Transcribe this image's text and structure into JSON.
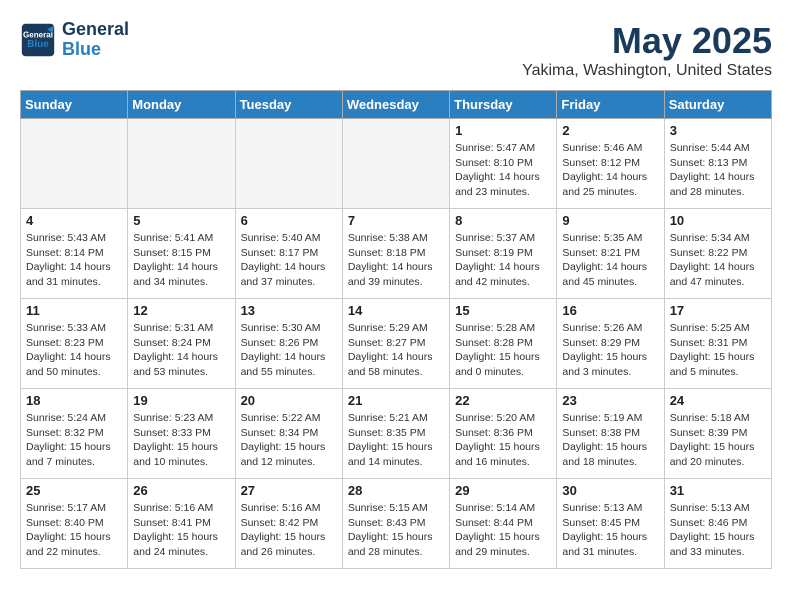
{
  "header": {
    "logo_line1": "General",
    "logo_line2": "Blue",
    "month_title": "May 2025",
    "location": "Yakima, Washington, United States"
  },
  "columns": [
    "Sunday",
    "Monday",
    "Tuesday",
    "Wednesday",
    "Thursday",
    "Friday",
    "Saturday"
  ],
  "weeks": [
    [
      {
        "day": "",
        "info": ""
      },
      {
        "day": "",
        "info": ""
      },
      {
        "day": "",
        "info": ""
      },
      {
        "day": "",
        "info": ""
      },
      {
        "day": "1",
        "info": "Sunrise: 5:47 AM\nSunset: 8:10 PM\nDaylight: 14 hours\nand 23 minutes."
      },
      {
        "day": "2",
        "info": "Sunrise: 5:46 AM\nSunset: 8:12 PM\nDaylight: 14 hours\nand 25 minutes."
      },
      {
        "day": "3",
        "info": "Sunrise: 5:44 AM\nSunset: 8:13 PM\nDaylight: 14 hours\nand 28 minutes."
      }
    ],
    [
      {
        "day": "4",
        "info": "Sunrise: 5:43 AM\nSunset: 8:14 PM\nDaylight: 14 hours\nand 31 minutes."
      },
      {
        "day": "5",
        "info": "Sunrise: 5:41 AM\nSunset: 8:15 PM\nDaylight: 14 hours\nand 34 minutes."
      },
      {
        "day": "6",
        "info": "Sunrise: 5:40 AM\nSunset: 8:17 PM\nDaylight: 14 hours\nand 37 minutes."
      },
      {
        "day": "7",
        "info": "Sunrise: 5:38 AM\nSunset: 8:18 PM\nDaylight: 14 hours\nand 39 minutes."
      },
      {
        "day": "8",
        "info": "Sunrise: 5:37 AM\nSunset: 8:19 PM\nDaylight: 14 hours\nand 42 minutes."
      },
      {
        "day": "9",
        "info": "Sunrise: 5:35 AM\nSunset: 8:21 PM\nDaylight: 14 hours\nand 45 minutes."
      },
      {
        "day": "10",
        "info": "Sunrise: 5:34 AM\nSunset: 8:22 PM\nDaylight: 14 hours\nand 47 minutes."
      }
    ],
    [
      {
        "day": "11",
        "info": "Sunrise: 5:33 AM\nSunset: 8:23 PM\nDaylight: 14 hours\nand 50 minutes."
      },
      {
        "day": "12",
        "info": "Sunrise: 5:31 AM\nSunset: 8:24 PM\nDaylight: 14 hours\nand 53 minutes."
      },
      {
        "day": "13",
        "info": "Sunrise: 5:30 AM\nSunset: 8:26 PM\nDaylight: 14 hours\nand 55 minutes."
      },
      {
        "day": "14",
        "info": "Sunrise: 5:29 AM\nSunset: 8:27 PM\nDaylight: 14 hours\nand 58 minutes."
      },
      {
        "day": "15",
        "info": "Sunrise: 5:28 AM\nSunset: 8:28 PM\nDaylight: 15 hours\nand 0 minutes."
      },
      {
        "day": "16",
        "info": "Sunrise: 5:26 AM\nSunset: 8:29 PM\nDaylight: 15 hours\nand 3 minutes."
      },
      {
        "day": "17",
        "info": "Sunrise: 5:25 AM\nSunset: 8:31 PM\nDaylight: 15 hours\nand 5 minutes."
      }
    ],
    [
      {
        "day": "18",
        "info": "Sunrise: 5:24 AM\nSunset: 8:32 PM\nDaylight: 15 hours\nand 7 minutes."
      },
      {
        "day": "19",
        "info": "Sunrise: 5:23 AM\nSunset: 8:33 PM\nDaylight: 15 hours\nand 10 minutes."
      },
      {
        "day": "20",
        "info": "Sunrise: 5:22 AM\nSunset: 8:34 PM\nDaylight: 15 hours\nand 12 minutes."
      },
      {
        "day": "21",
        "info": "Sunrise: 5:21 AM\nSunset: 8:35 PM\nDaylight: 15 hours\nand 14 minutes."
      },
      {
        "day": "22",
        "info": "Sunrise: 5:20 AM\nSunset: 8:36 PM\nDaylight: 15 hours\nand 16 minutes."
      },
      {
        "day": "23",
        "info": "Sunrise: 5:19 AM\nSunset: 8:38 PM\nDaylight: 15 hours\nand 18 minutes."
      },
      {
        "day": "24",
        "info": "Sunrise: 5:18 AM\nSunset: 8:39 PM\nDaylight: 15 hours\nand 20 minutes."
      }
    ],
    [
      {
        "day": "25",
        "info": "Sunrise: 5:17 AM\nSunset: 8:40 PM\nDaylight: 15 hours\nand 22 minutes."
      },
      {
        "day": "26",
        "info": "Sunrise: 5:16 AM\nSunset: 8:41 PM\nDaylight: 15 hours\nand 24 minutes."
      },
      {
        "day": "27",
        "info": "Sunrise: 5:16 AM\nSunset: 8:42 PM\nDaylight: 15 hours\nand 26 minutes."
      },
      {
        "day": "28",
        "info": "Sunrise: 5:15 AM\nSunset: 8:43 PM\nDaylight: 15 hours\nand 28 minutes."
      },
      {
        "day": "29",
        "info": "Sunrise: 5:14 AM\nSunset: 8:44 PM\nDaylight: 15 hours\nand 29 minutes."
      },
      {
        "day": "30",
        "info": "Sunrise: 5:13 AM\nSunset: 8:45 PM\nDaylight: 15 hours\nand 31 minutes."
      },
      {
        "day": "31",
        "info": "Sunrise: 5:13 AM\nSunset: 8:46 PM\nDaylight: 15 hours\nand 33 minutes."
      }
    ]
  ]
}
